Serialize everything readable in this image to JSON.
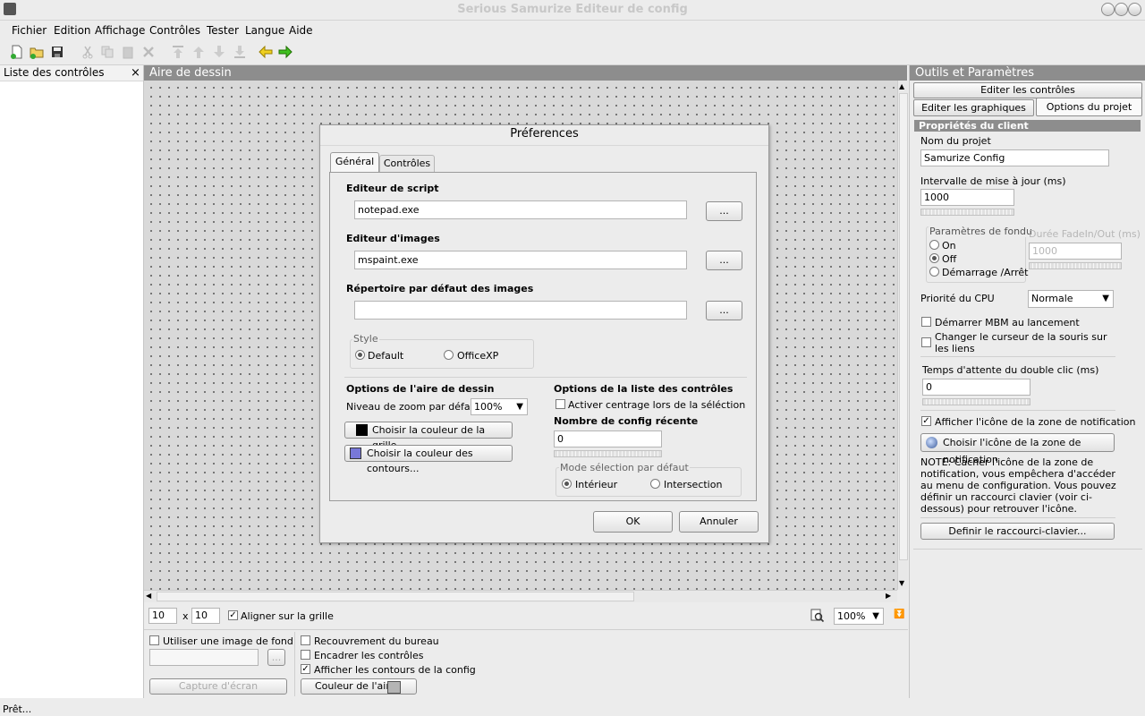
{
  "window": {
    "title": "Serious Samurize Editeur de config"
  },
  "menu": [
    "Fichier",
    "Edition",
    "Affichage",
    "Contrôles",
    "Tester",
    "Langue",
    "Aide"
  ],
  "left_panel": {
    "title": "Liste des contrôles",
    "close": "×"
  },
  "canvas": {
    "title": "Aire de dessin"
  },
  "right_panel": {
    "title": "Outils et Paramètres",
    "tab_edit_controls": "Editer les contrôles",
    "tab_edit_graphics": "Editer les graphiques",
    "tab_project_options": "Options du projet",
    "section": "Propriétés du client",
    "project_name_label": "Nom du projet",
    "project_name": "Samurize Config",
    "update_interval_label": "Intervalle de mise à jour (ms)",
    "update_interval": "1000",
    "fade_params_label": "Paramètres de fondu",
    "fade_on": "On",
    "fade_off": "Off",
    "fade_startstop": "Démarrage /Arrêt",
    "fade_duration_label": "Durée FadeIn/Out (ms)",
    "fade_duration": "1000",
    "cpu_priority_label": "Priorité du CPU",
    "cpu_priority": "Normale",
    "start_mbm": "Démarrer MBM au lancement",
    "change_cursor": "Changer le curseur de la souris sur les liens",
    "dblclick_label": "Temps d'attente du double clic (ms)",
    "dblclick": "0",
    "show_tray_icon": "Afficher l'icône de la zone de notification",
    "choose_tray_icon": "Choisir l'icône de la zone de notification",
    "note": "NOTE: Cacher l'icône de la zone de notification, vous empêchera d'accéder au menu de configuration. Vous pouvez définir un raccourci clavier (voir ci-dessous) pour retrouver l'icône.",
    "define_shortcut": "Definir le raccourci-clavier..."
  },
  "bottom": {
    "grid_x": "10",
    "x_sep": "x",
    "grid_y": "10",
    "snap_grid": "Aligner sur la grille",
    "zoom": "100%",
    "use_bg_image": "Utiliser une image de fond",
    "browse": "...",
    "screen_capture": "Capture d'écran",
    "desktop_overlay": "Recouvrement du bureau",
    "frame_controls": "Encadrer les contrôles",
    "show_outlines": "Afficher les contours de la config",
    "area_color": "Couleur de l'aire"
  },
  "status": "Prêt...",
  "dialog": {
    "title": "Préferences",
    "tab_general": "Général",
    "tab_controls": "Contrôles",
    "script_editor_label": "Editeur de script",
    "script_editor": "notepad.exe",
    "image_editor_label": "Editeur d'images",
    "image_editor": "mspaint.exe",
    "image_dir_label": "Répertoire par défaut des images",
    "image_dir": "",
    "browse": "...",
    "style_label": "Style",
    "style_default": "Default",
    "style_officexp": "OfficeXP",
    "canvas_options_label": "Options de l'aire de dessin",
    "zoom_label": "Niveau de zoom par défaut",
    "zoom": "100%",
    "grid_color_btn": "Choisir la couleur de la grille...",
    "outline_color_btn": "Choisir la couleur des contours...",
    "list_options_label": "Options de la liste des contrôles",
    "center_selection": "Activer centrage lors de la séléction",
    "recent_count_label": "Nombre de config récente",
    "recent_count": "0",
    "selection_mode_label": "Mode sélection par défaut",
    "mode_inside": "Intérieur",
    "mode_intersection": "Intersection",
    "ok": "OK",
    "cancel": "Annuler"
  },
  "colors": {
    "grid": "#000000",
    "outline": "#7878d8",
    "area": "#b4b4b4"
  }
}
